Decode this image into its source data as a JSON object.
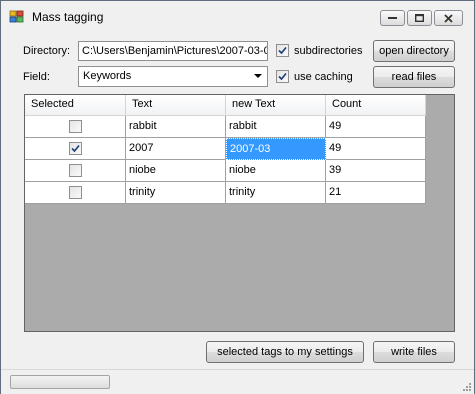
{
  "window": {
    "title": "Mass tagging",
    "icon": "tags-app-icon",
    "controls": [
      "minimize-icon",
      "maximize-icon",
      "close-icon"
    ]
  },
  "form": {
    "directory_label": "Directory:",
    "directory_value": "C:\\Users\\Benjamin\\Pictures\\2007-03-0",
    "subdirectories_label": "subdirectories",
    "subdirectories_checked": true,
    "open_directory_label": "open directory",
    "field_label": "Field:",
    "field_value": "Keywords",
    "use_caching_label": "use caching",
    "use_caching_checked": true,
    "read_files_label": "read files"
  },
  "grid": {
    "columns": [
      "Selected",
      "Text",
      "new Text",
      "Count"
    ],
    "rows": [
      {
        "selected": false,
        "text": "rabbit",
        "new_text": "rabbit",
        "count": "49"
      },
      {
        "selected": true,
        "text": "2007",
        "new_text": "2007-03",
        "count": "49"
      },
      {
        "selected": false,
        "text": "niobe",
        "new_text": "niobe",
        "count": "39"
      },
      {
        "selected": false,
        "text": "trinity",
        "new_text": "trinity",
        "count": "21"
      }
    ],
    "selected_cell": {
      "row": 1,
      "column": "new_text"
    }
  },
  "actions": {
    "selected_tags_label": "selected tags to my settings",
    "write_files_label": "write files"
  },
  "statusbar": {
    "progress": 0
  },
  "colors": {
    "selection": "#3399ff",
    "grid_background": "#ababab",
    "window_background": "#f0f0f0"
  }
}
